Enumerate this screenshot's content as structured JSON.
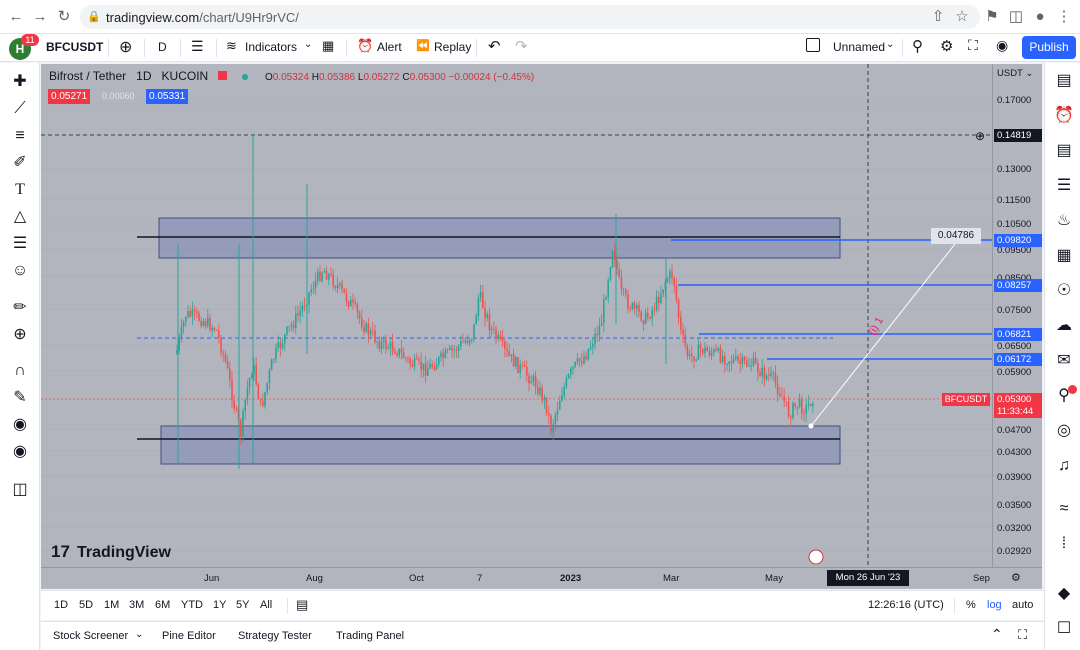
{
  "browser": {
    "url_host": "tradingview.com",
    "url_path": "/chart/U9Hr9rVC/"
  },
  "toolbar": {
    "avatar_letter": "H",
    "notif_count": "11",
    "symbol": "BFCUSDT",
    "interval": "D",
    "indicators": "Indicators",
    "alert": "Alert",
    "replay": "Replay",
    "layout_name": "Unnamed",
    "publish": "Publish"
  },
  "legend": {
    "name": "Bifrost / Tether",
    "interval": "1D",
    "exchange": "KUCOIN",
    "o_label": "O",
    "o": "0.05324",
    "h_label": "H",
    "h": "0.05386",
    "l_label": "L",
    "l": "0.05272",
    "c_label": "C",
    "c": "0.05300",
    "change": "−0.00024 (−0.45%)",
    "bid": "0.05271",
    "spread": "0.00060",
    "ask": "0.05331"
  },
  "price_axis": {
    "currency": "USDT",
    "ticks": [
      "0.17000",
      "0.14819",
      "0.13000",
      "0.11500",
      "0.10500",
      "0.09500",
      "0.08500",
      "0.07500",
      "0.06500",
      "0.05900",
      "0.04700",
      "0.04300",
      "0.03900",
      "0.03500",
      "0.03200",
      "0.02920"
    ],
    "labels": {
      "crosshair": "0.14819",
      "l1": "0.09820",
      "l2": "0.08257",
      "l3": "0.06821",
      "l4": "0.06172",
      "last": "0.05300",
      "countdown": "11:33:44",
      "symbol_tag": "BFCUSDT",
      "target": "0.04786"
    }
  },
  "time_axis": {
    "ticks": [
      "Jun",
      "Aug",
      "Oct",
      "7",
      "2023",
      "Mar",
      "May",
      "Sep"
    ],
    "crosshair": "Mon 26 Jun '23"
  },
  "chart_data": {
    "type": "candlestick",
    "title": "Bifrost / Tether",
    "interval": "1D",
    "exchange": "KUCOIN",
    "ylim": [
      0.0292,
      0.17
    ],
    "x_ticks": [
      "Jun",
      "Aug",
      "Oct",
      "7",
      "2023",
      "Mar",
      "May",
      "Sep"
    ],
    "price_lines": [
      0.0982,
      0.08257,
      0.06821,
      0.06172
    ],
    "supply_zone": [
      0.0945,
      0.1045
    ],
    "demand_zone": [
      0.0425,
      0.0475
    ],
    "last_price": 0.053,
    "target_annotation": 0.04786
  },
  "watermark": "TradingView",
  "range": {
    "items": [
      "1D",
      "5D",
      "1M",
      "3M",
      "6M",
      "YTD",
      "1Y",
      "5Y",
      "All"
    ],
    "clock": "12:26:16 (UTC)",
    "pct": "%",
    "log": "log",
    "auto": "auto"
  },
  "bottom": {
    "stock_screener": "Stock Screener",
    "pine_editor": "Pine Editor",
    "strategy_tester": "Strategy Tester",
    "trading_panel": "Trading Panel"
  },
  "colors": {
    "accent": "#2962ff",
    "up": "#26a69a",
    "down": "#ef5350",
    "chart_bg": "#b2b5be"
  }
}
